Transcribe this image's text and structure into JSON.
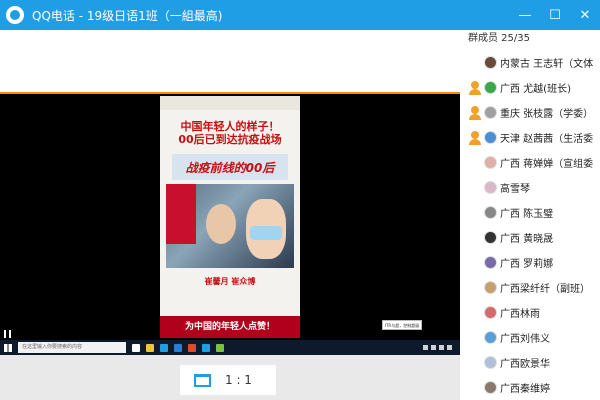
{
  "window": {
    "title": "QQ电话 - 19级日语1班（一組最高)",
    "minimize": "—",
    "maximize": "☐",
    "close": "✕"
  },
  "video": {
    "phone": {
      "headline_line1": "中国年轻人的样子！",
      "headline_line2": "00后已到达抗疫战场",
      "banner": "战疫前线的00后",
      "names": "崔馨月  崔众博",
      "bottom_text": "为中国的年轻人点赞！"
    },
    "tooltip": "ITR与超，控制超级"
  },
  "taskbar": {
    "search_placeholder": "在这里输入你要搜索的内容"
  },
  "bottom": {
    "ratio_label": "1 : 1"
  },
  "members": {
    "header": "群成员 25/35",
    "list": [
      {
        "name": "内蒙古  王志轩（文体",
        "role": "none",
        "avatar_color": "#6a4a3a"
      },
      {
        "name": "广西 尤越(班长)",
        "role": "admin",
        "avatar_color": "#39a84a"
      },
      {
        "name": "重庆 张枝露（学委）",
        "role": "admin",
        "avatar_color": "#a0a0a0"
      },
      {
        "name": "天津  赵茜茜（生活委",
        "role": "admin",
        "avatar_color": "#4a8fd6"
      },
      {
        "name": "广西 蒋婵婵（宣组委",
        "role": "none",
        "avatar_color": "#e0b0a8"
      },
      {
        "name": "高雪琴",
        "role": "none",
        "avatar_color": "#d9b8c8"
      },
      {
        "name": "广西    陈玉璧",
        "role": "none",
        "avatar_color": "#888888"
      },
      {
        "name": "广西 黄晓晟",
        "role": "none",
        "avatar_color": "#333333"
      },
      {
        "name": "广西 罗莉娜",
        "role": "none",
        "avatar_color": "#7a6aa8"
      },
      {
        "name": "广西梁纤纤（副班）",
        "role": "none",
        "avatar_color": "#c8a070"
      },
      {
        "name": "广西林雨",
        "role": "none",
        "avatar_color": "#d46a6a"
      },
      {
        "name": "广西刘伟义",
        "role": "none",
        "avatar_color": "#5aa0d8"
      },
      {
        "name": "广西欧景华",
        "role": "none",
        "avatar_color": "#b0c0d8"
      },
      {
        "name": "广西秦维婷",
        "role": "none",
        "avatar_color": "#8a7a6a"
      }
    ]
  }
}
